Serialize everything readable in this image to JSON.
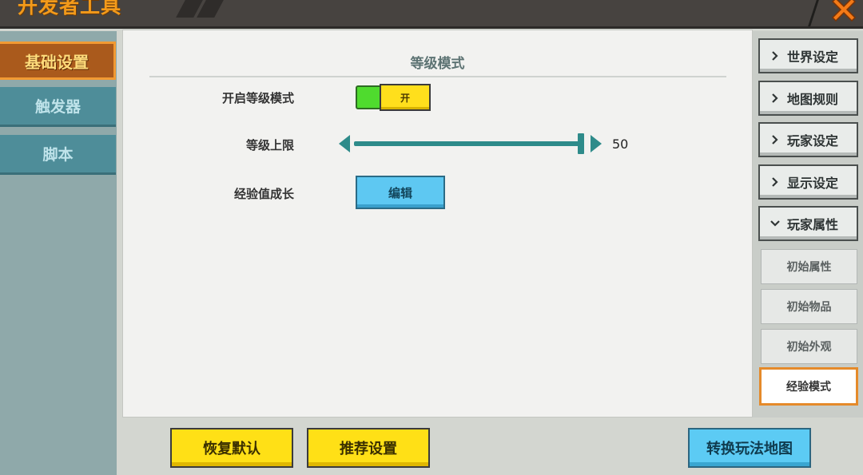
{
  "header": {
    "title": "开发者工具"
  },
  "sidebar": {
    "tabs": [
      {
        "label": "基础设置",
        "active": true
      },
      {
        "label": "触发器",
        "active": false
      },
      {
        "label": "脚本",
        "active": false
      }
    ]
  },
  "main": {
    "section_title": "等级模式",
    "rows": {
      "level_mode": {
        "label": "开启等级模式",
        "toggle_label": "开",
        "enabled": true
      },
      "level_cap": {
        "label": "等级上限",
        "value": "50",
        "fraction": 1.0
      },
      "exp_growth": {
        "label": "经验值成长",
        "button_label": "编辑"
      }
    }
  },
  "right_panel": {
    "categories": [
      {
        "label": "世界设定",
        "expanded": false
      },
      {
        "label": "地图规则",
        "expanded": false
      },
      {
        "label": "玩家设定",
        "expanded": false
      },
      {
        "label": "显示设定",
        "expanded": false
      },
      {
        "label": "玩家属性",
        "expanded": true
      }
    ],
    "subitems": [
      {
        "label": "初始属性",
        "active": false
      },
      {
        "label": "初始物品",
        "active": false
      },
      {
        "label": "初始外观",
        "active": false
      },
      {
        "label": "经验模式",
        "active": true
      }
    ]
  },
  "footer": {
    "restore_default": "恢复默认",
    "recommended": "推荐设置",
    "convert_map": "转换玩法地图"
  },
  "colors": {
    "accent_orange": "#f39a1a",
    "teal": "#2e8b8a",
    "toggle_green": "#4fdb2e",
    "button_yellow": "#ffe016",
    "button_blue": "#5ccbf4"
  }
}
